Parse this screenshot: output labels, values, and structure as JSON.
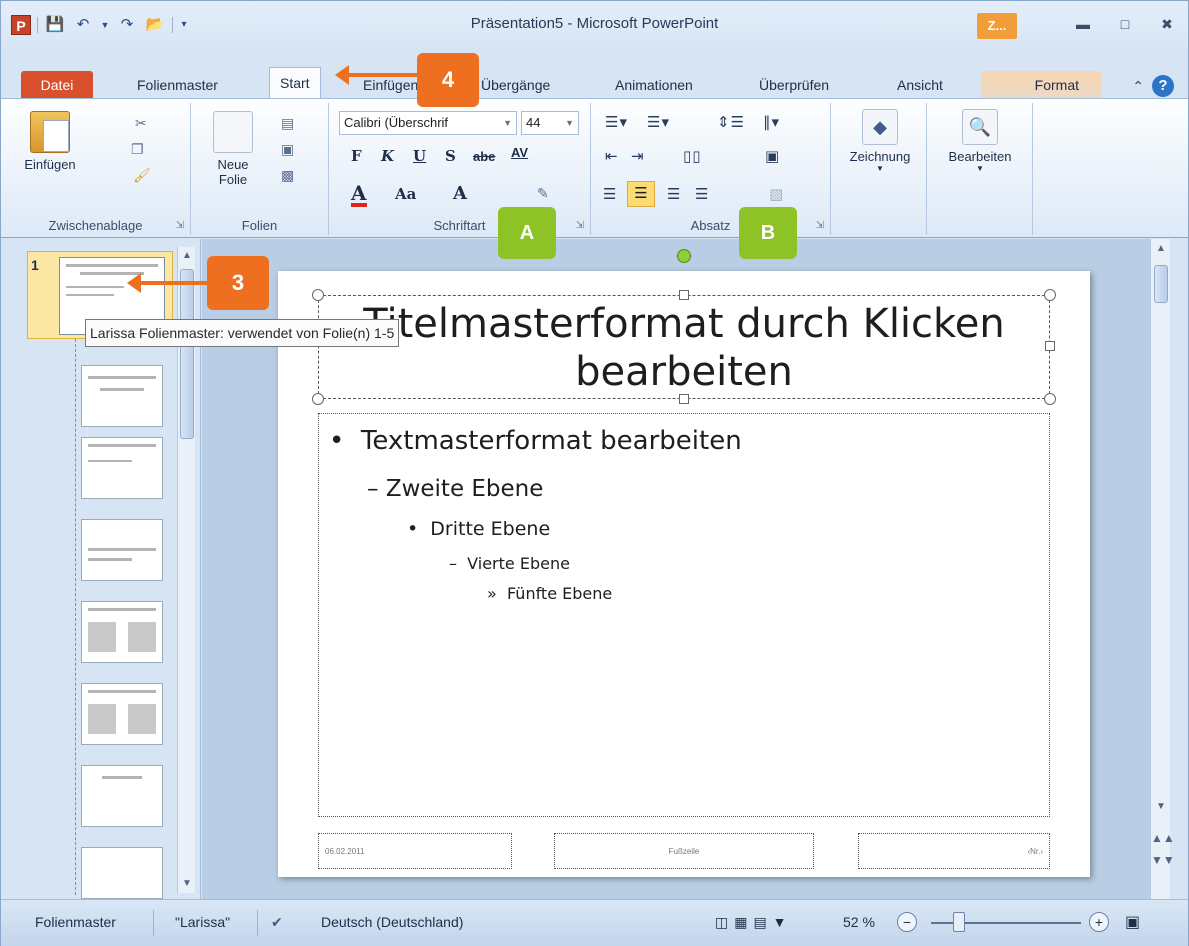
{
  "window": {
    "title": "Präsentation5 - Microsoft PowerPoint",
    "app_icon_letter": "P",
    "context_tab_badge": "Z..."
  },
  "tabs": {
    "datei": "Datei",
    "folienmaster": "Folienmaster",
    "start": "Start",
    "einfuegen": "Einfügen",
    "uebergaenge": "Übergänge",
    "animationen": "Animationen",
    "ueberpruefen": "Überprüfen",
    "ansicht": "Ansicht",
    "format": "Format"
  },
  "ribbon": {
    "clipboard": {
      "paste_label": "Einfügen",
      "group_label": "Zwischenablage"
    },
    "slides": {
      "new_slide_label_1": "Neue",
      "new_slide_label_2": "Folie",
      "group_label": "Folien"
    },
    "font": {
      "font_name": "Calibri (Überschrif",
      "font_size": "44",
      "bold": "F",
      "italic": "K",
      "underline": "U",
      "shadow": "S",
      "strike": "abe",
      "spacing": "AV",
      "font_color": "A",
      "case": "Aa",
      "grow": "A",
      "group_label": "Schriftart"
    },
    "paragraph": {
      "group_label": "Absatz"
    },
    "drawing": {
      "label": "Zeichnung"
    },
    "editing": {
      "label": "Bearbeiten"
    }
  },
  "markers": {
    "m4": "4",
    "m3": "3",
    "mA": "A",
    "mB": "B"
  },
  "thumbnails": {
    "master_number": "1",
    "tooltip": "Larissa Folienmaster: verwendet von Folie(n) 1-5"
  },
  "slide": {
    "title_line1": "Titelmasterformat durch Klicken",
    "title_line2": "bearbeiten",
    "level1": "Textmasterformat bearbeiten",
    "level2": "Zweite Ebene",
    "level3": "Dritte Ebene",
    "level4": "Vierte Ebene",
    "level5": "Fünfte Ebene",
    "footer_date": "06.02.2011",
    "footer_text": "Fußzeile",
    "footer_num": "‹Nr.›"
  },
  "statusbar": {
    "view": "Folienmaster",
    "theme": "\"Larissa\"",
    "language": "Deutsch (Deutschland)",
    "zoom": "52 %"
  },
  "colors": {
    "accent_orange": "#ee6f1f",
    "accent_green": "#8dc326",
    "datei_tab": "#d8502d"
  }
}
